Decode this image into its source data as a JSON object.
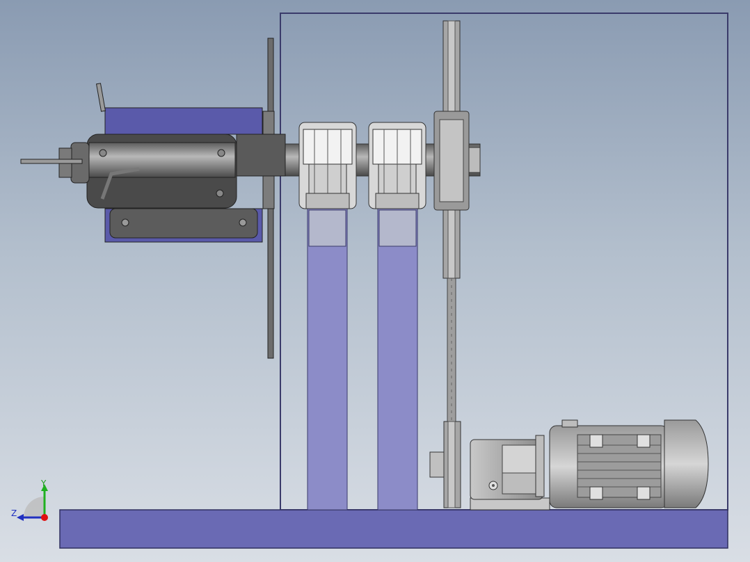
{
  "viewport": {
    "background_top": "#8a9bb2",
    "background_bottom": "#d9dee5"
  },
  "model": {
    "frame_color": "#6a6ab4",
    "support_color": "#8c8cc8",
    "metal_color": "#8a8a8a",
    "dark_metal_color": "#3e3e3e"
  },
  "triad": {
    "y_label": "Y",
    "z_label": "Z",
    "y_color": "#20b020",
    "z_color": "#2030c0",
    "x_color": "#e01010"
  }
}
